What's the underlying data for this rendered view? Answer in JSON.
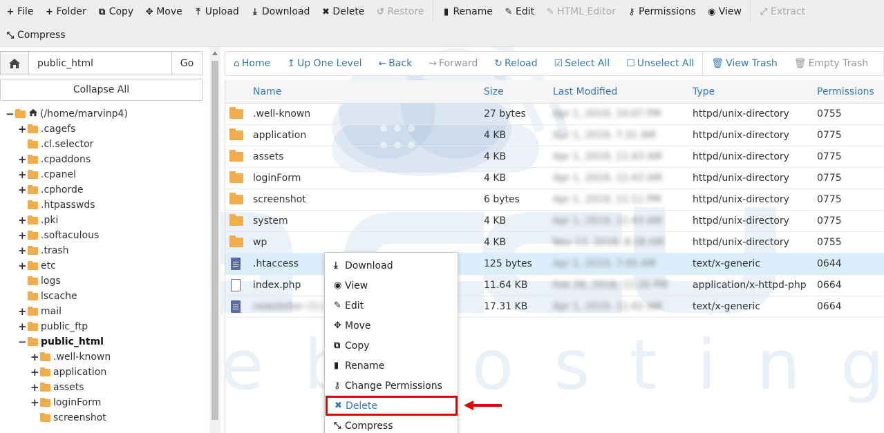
{
  "toolbar": {
    "row1": [
      {
        "icon": "plus-icon",
        "glyph": "+",
        "label": "File",
        "disabled": false
      },
      {
        "icon": "plus-icon",
        "glyph": "+",
        "label": "Folder",
        "disabled": false
      },
      {
        "icon": "copy-icon",
        "glyph": "⧉",
        "label": "Copy",
        "disabled": false
      },
      {
        "icon": "move-icon",
        "glyph": "✥",
        "label": "Move",
        "disabled": false
      },
      {
        "icon": "upload-icon",
        "glyph": "⤒",
        "label": "Upload",
        "disabled": false
      },
      {
        "icon": "download-icon",
        "glyph": "⤓",
        "label": "Download",
        "disabled": false
      },
      {
        "icon": "delete-icon",
        "glyph": "✖",
        "label": "Delete",
        "disabled": false
      },
      {
        "icon": "restore-icon",
        "glyph": "↺",
        "label": "Restore",
        "disabled": true
      },
      {
        "icon": "rename-icon",
        "glyph": "▮",
        "label": "Rename",
        "disabled": false
      },
      {
        "icon": "edit-icon",
        "glyph": "✎",
        "label": "Edit",
        "disabled": false
      },
      {
        "icon": "html-editor-icon",
        "glyph": "✎",
        "label": "HTML Editor",
        "disabled": true
      },
      {
        "icon": "permissions-icon",
        "glyph": "⚷",
        "label": "Permissions",
        "disabled": false
      },
      {
        "icon": "view-icon",
        "glyph": "◉",
        "label": "View",
        "disabled": false
      },
      {
        "icon": "extract-icon",
        "glyph": "⤢",
        "label": "Extract",
        "disabled": true
      }
    ],
    "row2": [
      {
        "icon": "compress-icon",
        "glyph": "⤡",
        "label": "Compress",
        "disabled": false
      }
    ]
  },
  "left_panel": {
    "path_value": "public_html",
    "go_label": "Go",
    "collapse_label": "Collapse All",
    "tree": [
      {
        "label": "(/home/marvinp4)",
        "sign": "−",
        "level": 0,
        "home": true,
        "bold": false
      },
      {
        "label": ".cagefs",
        "sign": "+",
        "level": 1,
        "bold": false
      },
      {
        "label": ".cl.selector",
        "sign": "",
        "level": 1,
        "bold": false
      },
      {
        "label": ".cpaddons",
        "sign": "+",
        "level": 1,
        "bold": false
      },
      {
        "label": ".cpanel",
        "sign": "+",
        "level": 1,
        "bold": false
      },
      {
        "label": ".cphorde",
        "sign": "+",
        "level": 1,
        "bold": false
      },
      {
        "label": ".htpasswds",
        "sign": "",
        "level": 1,
        "bold": false
      },
      {
        "label": ".pki",
        "sign": "+",
        "level": 1,
        "bold": false
      },
      {
        "label": ".softaculous",
        "sign": "+",
        "level": 1,
        "bold": false
      },
      {
        "label": ".trash",
        "sign": "+",
        "level": 1,
        "bold": false
      },
      {
        "label": "etc",
        "sign": "+",
        "level": 1,
        "bold": false
      },
      {
        "label": "logs",
        "sign": "",
        "level": 1,
        "bold": false
      },
      {
        "label": "lscache",
        "sign": "",
        "level": 1,
        "bold": false
      },
      {
        "label": "mail",
        "sign": "+",
        "level": 1,
        "bold": false
      },
      {
        "label": "public_ftp",
        "sign": "+",
        "level": 1,
        "bold": false
      },
      {
        "label": "public_html",
        "sign": "−",
        "level": 1,
        "bold": true
      },
      {
        "label": ".well-known",
        "sign": "+",
        "level": 2,
        "bold": false
      },
      {
        "label": "application",
        "sign": "+",
        "level": 2,
        "bold": false
      },
      {
        "label": "assets",
        "sign": "+",
        "level": 2,
        "bold": false
      },
      {
        "label": "loginForm",
        "sign": "+",
        "level": 2,
        "bold": false
      },
      {
        "label": "screenshot",
        "sign": "",
        "level": 2,
        "bold": false
      }
    ]
  },
  "nav": [
    {
      "icon": "home-icon",
      "glyph": "⌂",
      "label": "Home",
      "disabled": false
    },
    {
      "icon": "up-level-icon",
      "glyph": "↥",
      "label": "Up One Level",
      "disabled": false
    },
    {
      "icon": "back-icon",
      "glyph": "←",
      "label": "Back",
      "disabled": false
    },
    {
      "icon": "forward-icon",
      "glyph": "→",
      "label": "Forward",
      "disabled": true
    },
    {
      "icon": "reload-icon",
      "glyph": "↻",
      "label": "Reload",
      "disabled": false
    },
    {
      "icon": "select-all-icon",
      "glyph": "☑",
      "label": "Select All",
      "disabled": false
    },
    {
      "icon": "unselect-all-icon",
      "glyph": "☐",
      "label": "Unselect All",
      "disabled": false
    },
    {
      "icon": "view-trash-icon",
      "glyph": "🗑",
      "label": "View Trash",
      "disabled": false
    },
    {
      "icon": "empty-trash-icon",
      "glyph": "🗑",
      "label": "Empty Trash",
      "disabled": true
    }
  ],
  "table": {
    "headers": {
      "name": "Name",
      "size": "Size",
      "modified": "Last Modified",
      "type": "Type",
      "perms": "Permissions"
    },
    "rows": [
      {
        "icon": "folder",
        "name": ".well-known",
        "size": "27 bytes",
        "modified": "Apr 1, 2019, 10:07 PM",
        "type": "httpd/unix-directory",
        "perms": "0755",
        "blur_name": false,
        "selected": false
      },
      {
        "icon": "folder",
        "name": "application",
        "size": "4 KB",
        "modified": "Apr 1, 2019, 7:31 AM",
        "type": "httpd/unix-directory",
        "perms": "0775",
        "blur_name": false,
        "selected": false
      },
      {
        "icon": "folder",
        "name": "assets",
        "size": "4 KB",
        "modified": "Apr 1, 2019, 11:43 AM",
        "type": "httpd/unix-directory",
        "perms": "0775",
        "blur_name": false,
        "selected": false
      },
      {
        "icon": "folder",
        "name": "loginForm",
        "size": "4 KB",
        "modified": "Apr 1, 2019, 11:43 AM",
        "type": "httpd/unix-directory",
        "perms": "0775",
        "blur_name": false,
        "selected": false
      },
      {
        "icon": "folder",
        "name": "screenshot",
        "size": "6 bytes",
        "modified": "Apr 1, 2019, 11:11 PM",
        "type": "httpd/unix-directory",
        "perms": "0775",
        "blur_name": false,
        "selected": false
      },
      {
        "icon": "folder",
        "name": "system",
        "size": "4 KB",
        "modified": "Apr 1, 2019, 11:43 AM",
        "type": "httpd/unix-directory",
        "perms": "0775",
        "blur_name": false,
        "selected": false
      },
      {
        "icon": "folder",
        "name": "wp",
        "size": "4 KB",
        "modified": "Nov 13, 2018, 8:38 AM",
        "type": "httpd/unix-directory",
        "perms": "0755",
        "blur_name": false,
        "selected": false
      },
      {
        "icon": "file",
        "name": ".htaccess",
        "size": "125 bytes",
        "modified": "Apr 1, 2019, 7:45 AM",
        "type": "text/x-generic",
        "perms": "0644",
        "blur_name": false,
        "selected": true
      },
      {
        "icon": "php",
        "name": "index.php",
        "size": "11.64 KB",
        "modified": "Feb 28, 2018, 11:26 PM",
        "type": "application/x-httpd-php",
        "perms": "0664",
        "blur_name": false,
        "selected": false
      },
      {
        "icon": "file",
        "name": "newsletter (1).csv",
        "size": "17.31 KB",
        "modified": "Apr 1, 2019, 11:42 AM",
        "type": "text/x-generic",
        "perms": "0664",
        "blur_name": true,
        "selected": false
      }
    ]
  },
  "context_menu": [
    {
      "icon": "download-icon",
      "glyph": "⤓",
      "label": "Download",
      "highlight": false
    },
    {
      "icon": "view-icon",
      "glyph": "◉",
      "label": "View",
      "highlight": false
    },
    {
      "icon": "edit-icon",
      "glyph": "✎",
      "label": "Edit",
      "highlight": false
    },
    {
      "icon": "move-icon",
      "glyph": "✥",
      "label": "Move",
      "highlight": false
    },
    {
      "icon": "copy-icon",
      "glyph": "⧉",
      "label": "Copy",
      "highlight": false
    },
    {
      "icon": "rename-icon",
      "glyph": "▮",
      "label": "Rename",
      "highlight": false
    },
    {
      "icon": "permissions-icon",
      "glyph": "⚷",
      "label": "Change Permissions",
      "highlight": false
    },
    {
      "icon": "delete-icon",
      "glyph": "✖",
      "label": "Delete",
      "highlight": true
    },
    {
      "icon": "compress-icon",
      "glyph": "⤡",
      "label": "Compress",
      "highlight": false
    }
  ],
  "watermark": {
    "word": "webhosting"
  },
  "colors": {
    "link": "#337ab7",
    "folder": "#f0ad4e",
    "selected_row": "#dbeefb",
    "annotation": "#e00000"
  }
}
